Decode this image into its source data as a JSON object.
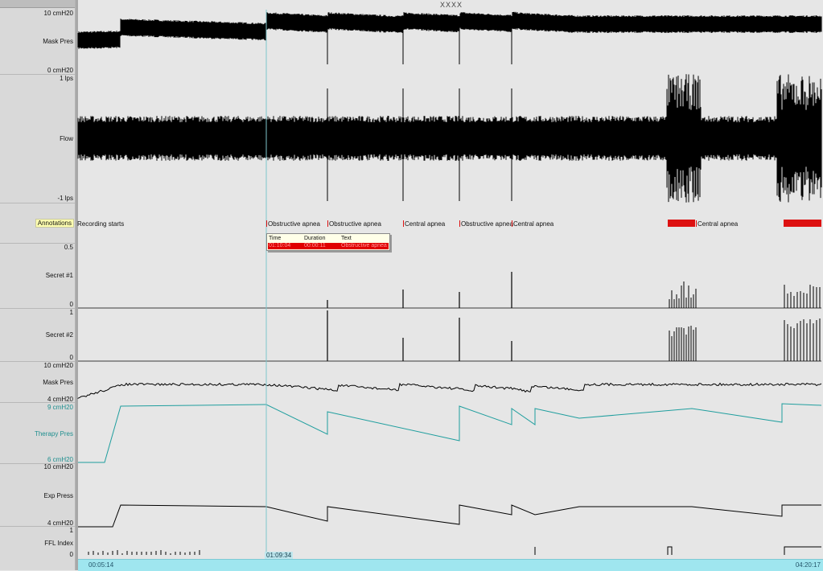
{
  "window": {
    "title": "XXXX"
  },
  "channels": [
    {
      "id": "mask1",
      "name": "Mask Pres",
      "range_top": "10 cmH20",
      "range_bottom": "0 cmH20"
    },
    {
      "id": "flow",
      "name": "Flow",
      "range_top": "1 lps",
      "range_bottom": "-1 lps"
    },
    {
      "id": "annotations",
      "name": "Annotations"
    },
    {
      "id": "secret1",
      "name": "Secret #1",
      "range_top": "0.5",
      "range_bottom": "0"
    },
    {
      "id": "secret2",
      "name": "Secret #2",
      "range_top": "1",
      "range_bottom": "0"
    },
    {
      "id": "mask2",
      "name": "Mask Pres",
      "range_top": "10 cmH20",
      "range_bottom": "4 cmH20"
    },
    {
      "id": "therapy",
      "name": "Therapy Pres",
      "range_top": "9 cmH20",
      "range_bottom": "6 cmH20"
    },
    {
      "id": "exp",
      "name": "Exp Press",
      "range_top": "10 cmH20",
      "range_bottom": "4 cmH20"
    },
    {
      "id": "ffl",
      "name": "FFL Index",
      "range_top": "1",
      "range_bottom": "0"
    }
  ],
  "annotations": [
    {
      "text": "Recording starts"
    },
    {
      "text": "Obstructive apnea"
    },
    {
      "text": "Obstructive apnea"
    },
    {
      "text": "Central apnea"
    },
    {
      "text": "Obstructive apnea"
    },
    {
      "text": "Central apnea"
    },
    {
      "text": "Central apnea"
    }
  ],
  "popup": {
    "columns": [
      "Time",
      "Duration",
      "Text"
    ],
    "row": {
      "time": "01:10:04",
      "duration": "00:00:11",
      "text": "Obstructive apnea"
    }
  },
  "timeline": {
    "start": "00:05:14",
    "cursor": "01:09:34",
    "end": "04:20:17"
  },
  "colors": {
    "trace": "#000000",
    "therapy": "#1f9e9e",
    "cursor": "#7fc6cc",
    "event": "#dd1111",
    "timeline": "#9fe6ef"
  }
}
